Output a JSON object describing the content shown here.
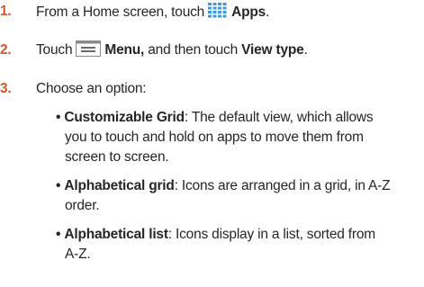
{
  "steps": [
    {
      "number": "1.",
      "text_before": "From a Home screen, touch",
      "icon": "apps-grid-icon",
      "bold": "Apps",
      "text_after": "."
    },
    {
      "number": "2.",
      "text_before": "Touch",
      "icon": "menu-icon",
      "bold_1": "Menu,",
      "text_middle": " and then touch ",
      "bold_2": "View type",
      "text_after": "."
    },
    {
      "number": "3.",
      "text": "Choose an option:"
    }
  ],
  "options": [
    {
      "bullet": "•",
      "term": "Customizable Grid",
      "lines": [
        ": The default view, which allows",
        "you to touch and hold on apps to move them from",
        "screen to screen."
      ]
    },
    {
      "bullet": "•",
      "term": "Alphabetical grid",
      "lines": [
        ": Icons are arranged in a grid, in A-Z",
        "order."
      ]
    },
    {
      "bullet": "•",
      "term": "Alphabetical list",
      "lines": [
        ": Icons display in a list, sorted from",
        "A-Z."
      ]
    }
  ],
  "colors": {
    "step_number": "#d2572a",
    "text": "#262626",
    "apps_icon_blue": "#3b9be0",
    "menu_icon_gray": "#8a8a8a"
  }
}
